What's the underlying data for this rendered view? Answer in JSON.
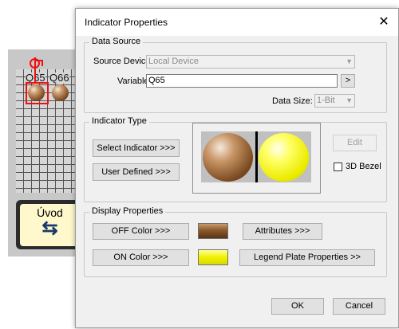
{
  "background": {
    "labels": [
      "Q65",
      "Q66"
    ],
    "uvod_label": "Úvod",
    "uvod_icon": "swap-arrows-icon"
  },
  "dialog": {
    "title": "Indicator Properties",
    "close_icon": "close-icon",
    "data_source": {
      "title": "Data Source",
      "source_device_label": "Source Device:",
      "source_device_value": "Local Device",
      "variable_label": "Variable",
      "variable_value": "Q65",
      "browse_label": ">",
      "data_size_label": "Data Size:",
      "data_size_value": "1-Bit"
    },
    "indicator_type": {
      "title": "Indicator Type",
      "select_indicator_label": "Select Indicator  >>>",
      "user_defined_label": "User Defined  >>>",
      "edit_label": "Edit",
      "bezel_label": "3D Bezel",
      "bezel_checked": false
    },
    "display_properties": {
      "title": "Display Properties",
      "off_color_label": "OFF Color >>>",
      "on_color_label": "ON Color >>>",
      "attributes_label": "Attributes >>>",
      "legend_label": "Legend Plate Properties >>",
      "off_color": "#8b5a2b",
      "on_color": "#f0f000"
    },
    "ok_label": "OK",
    "cancel_label": "Cancel"
  }
}
